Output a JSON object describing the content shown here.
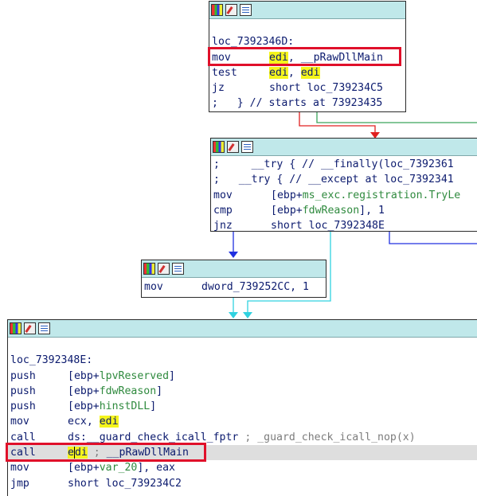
{
  "colors": {
    "node_header": "#c0e8ea",
    "highlight": "#f5f51c",
    "edge_true": "#e02020",
    "edge_false": "#3aa35a",
    "edge_jump": "#2030e0",
    "edge_flow": "#31d2e0",
    "red_box": "#e0102a"
  },
  "node1": {
    "label": "loc_7392346D:",
    "r1": {
      "mnem": "mov",
      "op_a": "edi",
      "sep": ", ",
      "op_b": "__pRawDllMain"
    },
    "r2": {
      "mnem": "test",
      "op_a": "edi",
      "sep": ", ",
      "op_b": "edi"
    },
    "r3": {
      "mnem": "jz",
      "ops": "short loc_739234C5"
    },
    "r4": {
      "text": ";   } // starts at 73923435"
    }
  },
  "node2": {
    "r1": {
      "text": ";     __try { // __finally(loc_7392361"
    },
    "r2": {
      "text": ";   __try { // __except at loc_7392341"
    },
    "r3": {
      "mnem": "mov",
      "pre": "[ebp+",
      "field": "ms_exc.registration.TryLe",
      "post": ""
    },
    "r4": {
      "mnem": "cmp",
      "pre": "[ebp+",
      "field": "fdwReason",
      "post": "], 1"
    },
    "r5": {
      "mnem": "jnz",
      "ops": "short loc_7392348E"
    }
  },
  "node3": {
    "r1": {
      "mnem": "mov",
      "ops": "dword_739252CC, 1"
    }
  },
  "node4": {
    "label": "loc_7392348E:",
    "r1": {
      "mnem": "push",
      "pre": "[ebp+",
      "field": "lpvReserved",
      "post": "]"
    },
    "r2": {
      "mnem": "push",
      "pre": "[ebp+",
      "field": "fdwReason",
      "post": "]"
    },
    "r3": {
      "mnem": "push",
      "pre": "[ebp+",
      "field": "hinstDLL",
      "post": "]"
    },
    "r4": {
      "mnem": "mov",
      "op_a": "ecx, ",
      "op_b": "edi"
    },
    "r5": {
      "mnem": "call",
      "op": "ds:__guard_check_icall_fptr",
      "comment": " ; _guard_check_icall_nop(x)"
    },
    "r6": {
      "mnem": "call",
      "op_a1": "e",
      "op_a2": "di",
      "comment1": " ; ",
      "comment2": "__pRawDllMain"
    },
    "r7": {
      "mnem": "mov",
      "pre": "[ebp+",
      "field": "var_20",
      "post": "], eax"
    },
    "r8": {
      "mnem": "jmp",
      "ops": "short loc_739234C2"
    }
  }
}
